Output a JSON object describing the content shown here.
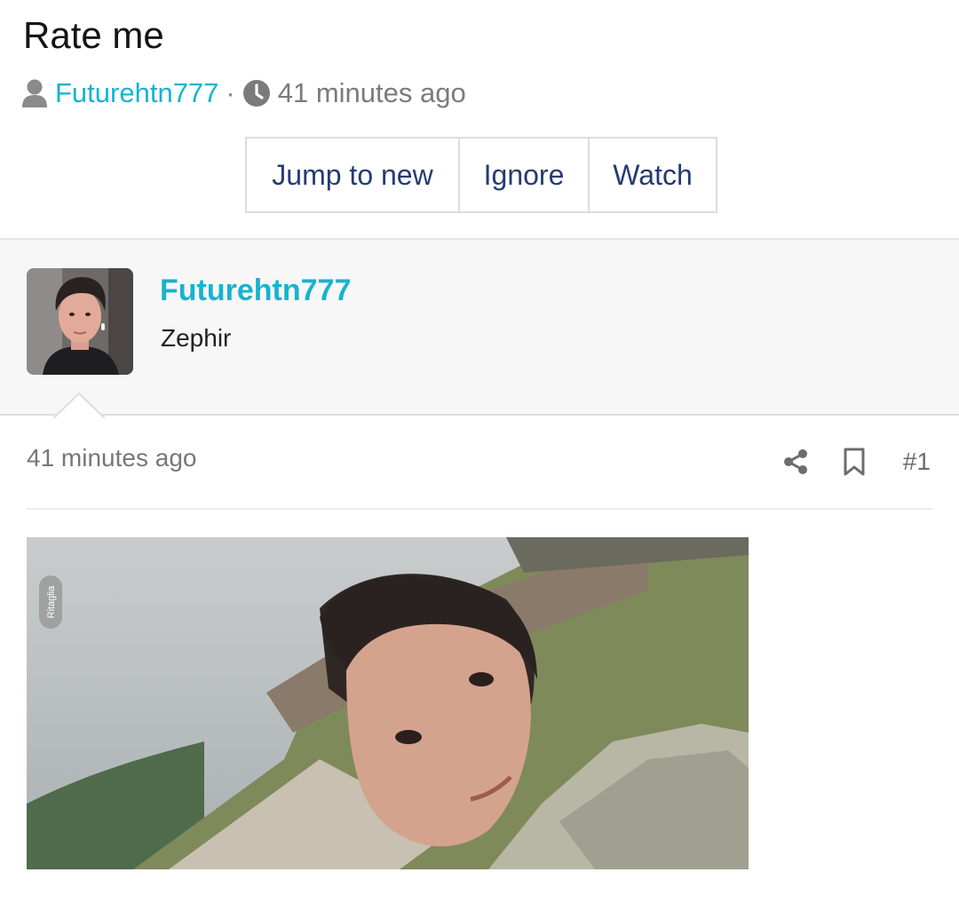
{
  "thread": {
    "title": "Rate me",
    "author": "Futurehtn777",
    "separator": "·",
    "time": "41 minutes ago"
  },
  "actions": {
    "jump_to_new": "Jump to new",
    "ignore": "Ignore",
    "watch": "Watch"
  },
  "post": {
    "username": "Futurehtn777",
    "user_title": "Zephir",
    "time": "41 minutes ago",
    "number": "#1",
    "image_tag": "Ritaglia"
  },
  "colors": {
    "link": "#17b3cf",
    "button_text": "#243b73",
    "muted": "#8a8a8a"
  },
  "icons": {
    "author": "user-icon",
    "time": "clock-icon",
    "share": "share-icon",
    "bookmark": "bookmark-icon"
  }
}
